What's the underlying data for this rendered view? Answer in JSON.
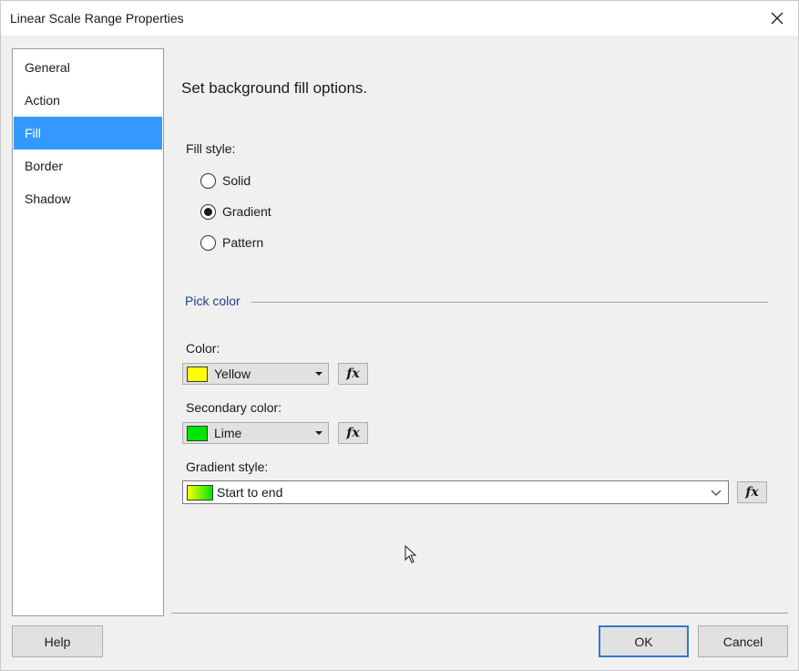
{
  "window": {
    "title": "Linear Scale Range Properties"
  },
  "nav": {
    "items": [
      {
        "label": "General",
        "selected": false
      },
      {
        "label": "Action",
        "selected": false
      },
      {
        "label": "Fill",
        "selected": true
      },
      {
        "label": "Border",
        "selected": false
      },
      {
        "label": "Shadow",
        "selected": false
      }
    ]
  },
  "main": {
    "heading": "Set background fill options.",
    "fill_style": {
      "label": "Fill style:",
      "options": [
        "Solid",
        "Gradient",
        "Pattern"
      ],
      "selected": "Gradient"
    },
    "pick_color": {
      "group_title": "Pick color",
      "color": {
        "label": "Color:",
        "value": "Yellow",
        "swatch": "#ffff00"
      },
      "secondary_color": {
        "label": "Secondary color:",
        "value": "Lime",
        "swatch": "#00e600"
      },
      "gradient_style": {
        "label": "Gradient style:",
        "value": "Start to end",
        "swatch_from": "#ffff00",
        "swatch_to": "#00e600"
      },
      "fx_symbol": "fx"
    }
  },
  "footer": {
    "help": "Help",
    "ok": "OK",
    "cancel": "Cancel"
  },
  "colors": {
    "selection": "#3399ff",
    "group_title": "#1e3f8a",
    "default_button_border": "#2f7bd0"
  }
}
